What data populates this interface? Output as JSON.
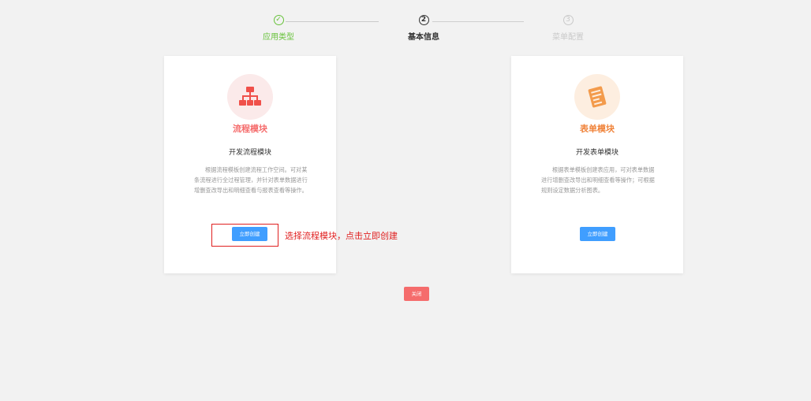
{
  "steps": [
    {
      "index": "✓",
      "label": "应用类型",
      "status": "done"
    },
    {
      "index": "2",
      "label": "基本信息",
      "status": "active"
    },
    {
      "index": "3",
      "label": "菜单配置",
      "status": "pending"
    }
  ],
  "cards": {
    "process": {
      "title": "流程模块",
      "subtitle": "开发流程模块",
      "description": "根据流程模板创建流程工作空间。可对某条流程进行全过程管理，并针对表单数据进行增删查改导出和明细查看与报表查看等操作。",
      "button_label": "立即创建",
      "icon": "org-chart-icon"
    },
    "form": {
      "title": "表单模块",
      "subtitle": "开发表单模块",
      "description": "根据表单模板创建表应用，可对表单数据进行增删查改导出和明细查看等操作；可根据规则设定数据分析图表。",
      "button_label": "立即创建",
      "icon": "form-document-icon"
    }
  },
  "annotation": {
    "text": "选择流程模块，点击立即创建"
  },
  "footer": {
    "close_label": "关闭"
  },
  "colors": {
    "primary": "#409eff",
    "success": "#67c23a",
    "danger": "#f56c6c",
    "orange": "#f0833a",
    "annotation": "#e02020"
  }
}
